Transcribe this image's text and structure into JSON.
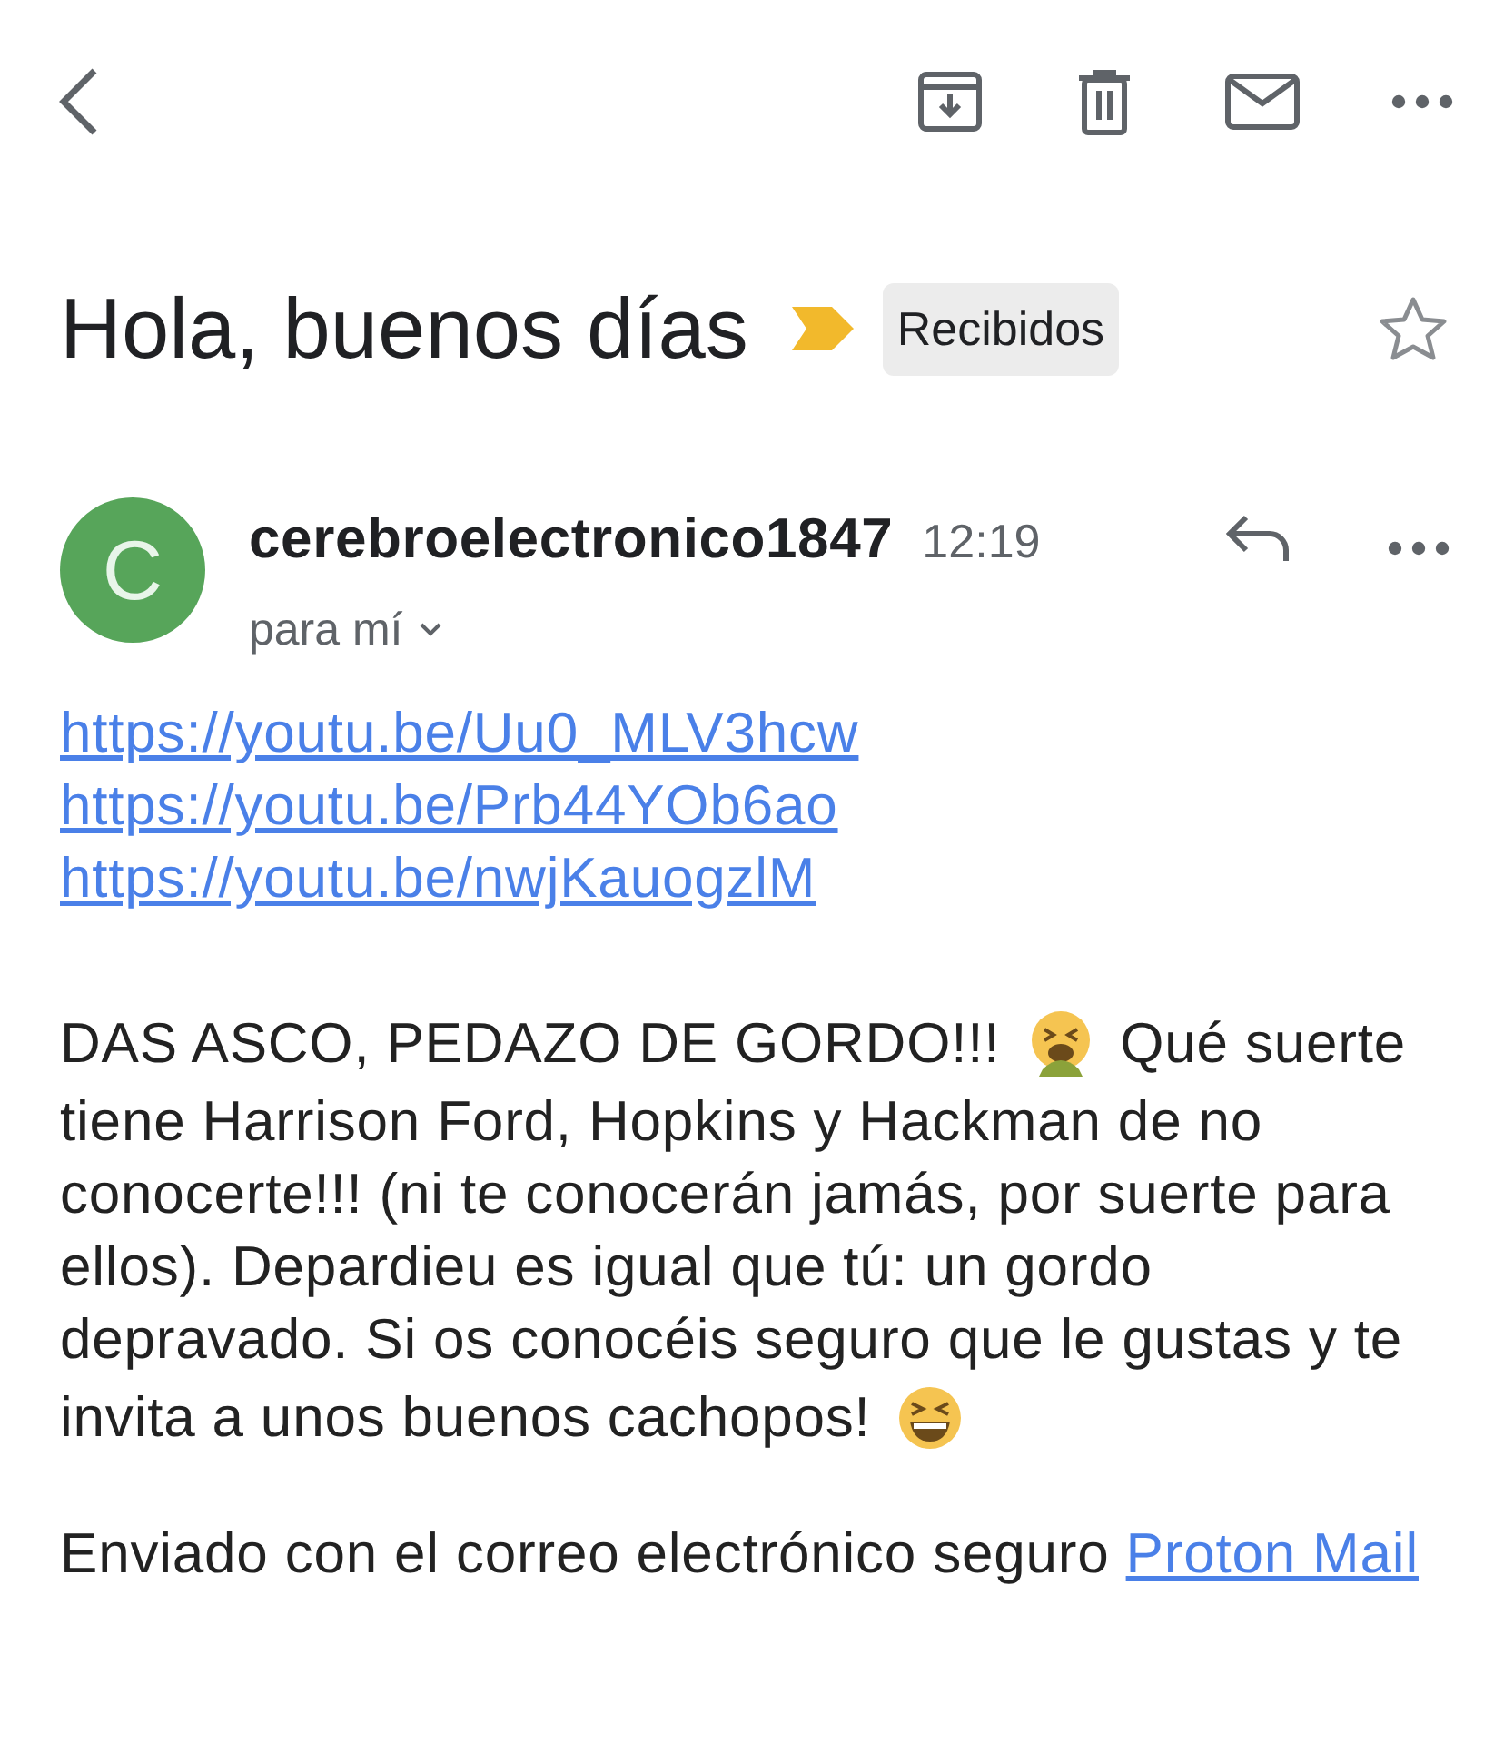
{
  "toolbar": {
    "actions": [
      {
        "kind": "archive"
      },
      {
        "kind": "delete"
      },
      {
        "kind": "mark-unread"
      },
      {
        "kind": "more"
      }
    ]
  },
  "subject": {
    "title": "Hola, buenos días",
    "important": true,
    "label": "Recibidos",
    "starred": false
  },
  "message": {
    "avatar_letter": "C",
    "sender": "cerebroelectronico1847",
    "time": "12:19",
    "recipient": "para mí",
    "links": [
      "https://youtu.be/Uu0_MLV3hcw",
      "https://youtu.be/Prb44YOb6ao",
      "https://youtu.be/nwjKauogzlM"
    ],
    "body": [
      [
        {
          "kind": "text",
          "text": "DAS ASCO, PEDAZO DE GORDO!!!"
        },
        {
          "kind": "emoji-sick"
        },
        {
          "kind": "text",
          "text": "Qué suerte"
        }
      ],
      [
        {
          "kind": "text",
          "text": "tiene Harrison Ford, Hopkins y Hackman de no conocerte!!! (ni te conocerán jamás, por suerte para ellos). Depardieu es igual que tú: un gordo depravado. Si os conocéis seguro que le gustas y te"
        }
      ],
      [
        {
          "kind": "text",
          "text": "invita a unos buenos cachopos!"
        },
        {
          "kind": "emoji-laugh"
        }
      ]
    ],
    "signature": {
      "text": "Enviado con el correo electrónico seguro",
      "link": "Proton Mail"
    }
  }
}
